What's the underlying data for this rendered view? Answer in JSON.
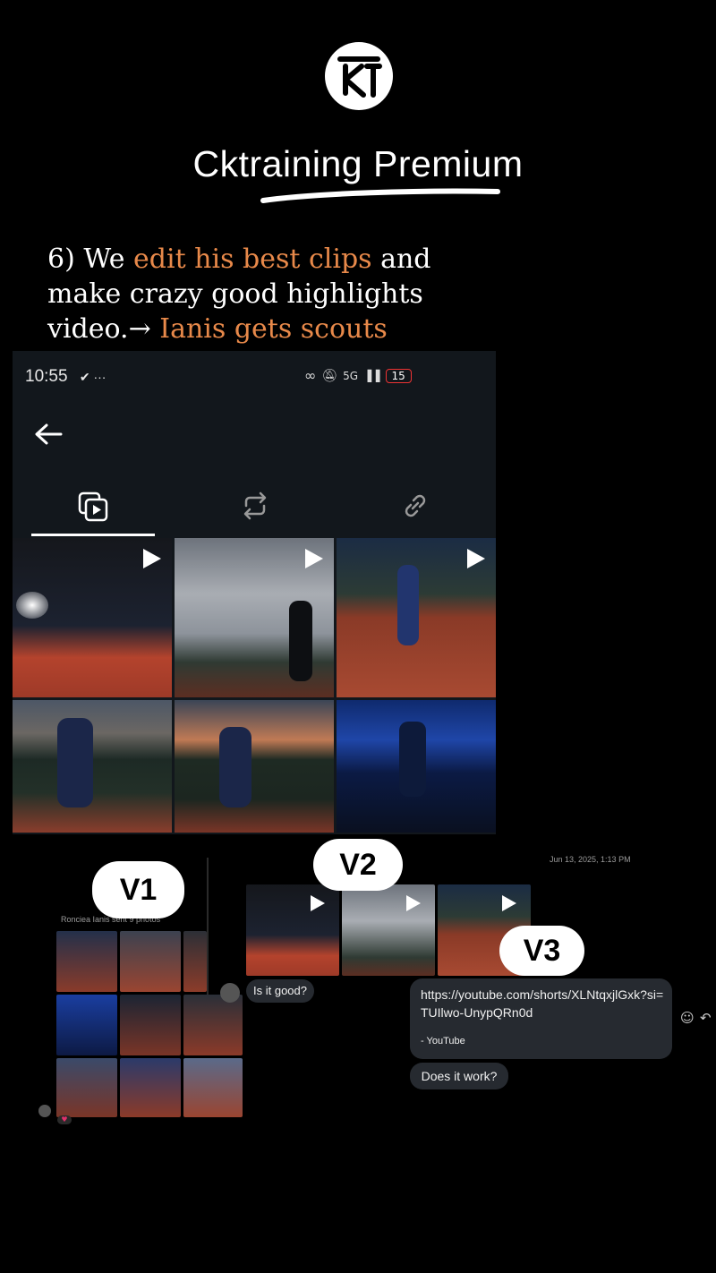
{
  "brand": {
    "name": "Cktraining Premium"
  },
  "caption": {
    "p1": "6) We ",
    "h1": "edit his best clips",
    "p2": " and make crazy good highlights video.→ ",
    "h2": "Ianis gets scouts attention"
  },
  "phone": {
    "time": "10:55",
    "status_extra": "✔ ···",
    "network": "5G",
    "battery": "15",
    "tabs": [
      "photos-videos-icon",
      "repost-icon",
      "link-icon"
    ]
  },
  "labels": {
    "v1": "V1",
    "v2": "V2",
    "v3": "V3"
  },
  "chat": {
    "timestamp": "Jun 13, 2025, 1:13 PM",
    "v1_caption": "Ronciea Ianis sent 9 photos",
    "is_it_good": "Is it good?",
    "link": "https://youtube.com/shorts/XLNtqxjlGxk?si=TUIlwo-UnypQRn0d",
    "link_source": "- YouTube",
    "does_it_work": "Does it work?"
  },
  "colors": {
    "accent": "#e8894a",
    "background": "#000000",
    "bubble": "#262a30"
  }
}
